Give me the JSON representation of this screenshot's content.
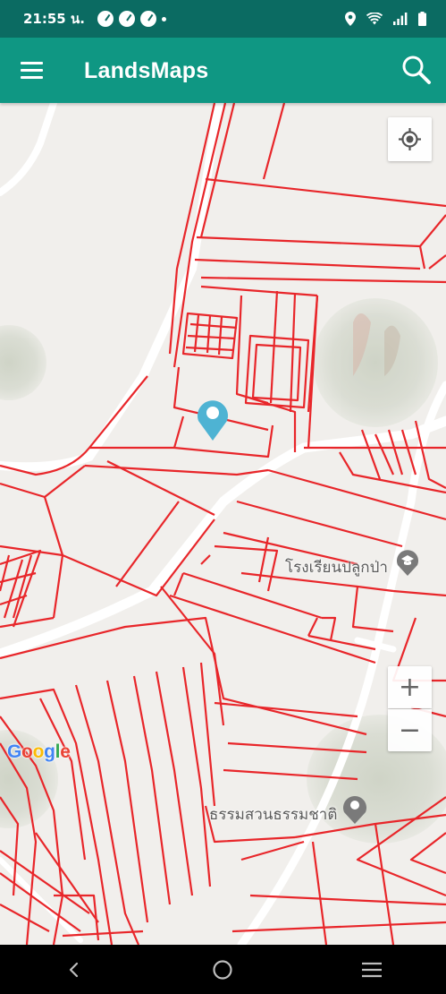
{
  "status_bar": {
    "time": "21:55 น.",
    "notification_icons": [
      "speedometer-icon",
      "speedometer-icon",
      "speedometer-icon",
      "dot-icon"
    ],
    "system_icons": [
      "location-icon",
      "wifi-icon",
      "signal-icon",
      "battery-icon"
    ]
  },
  "app_bar": {
    "title": "LandsMaps",
    "menu_icon": "hamburger-menu-icon",
    "search_icon": "search-icon",
    "background": "#0f9783"
  },
  "map": {
    "parcel_line_color": "#e8262a",
    "marker_color": "#4eb3d3",
    "pois": [
      {
        "label": "โรงเรียนปลูกป่า",
        "icon": "school-pin-icon"
      },
      {
        "label": "ธรรมสวนธรรมชาติ",
        "icon": "place-pin-icon"
      }
    ],
    "controls": {
      "my_location_icon": "my-location-icon",
      "zoom_in": "+",
      "zoom_out": "−"
    },
    "attribution": "Google"
  },
  "nav_bar": {
    "buttons": [
      "back-icon",
      "home-icon",
      "recents-icon"
    ]
  }
}
